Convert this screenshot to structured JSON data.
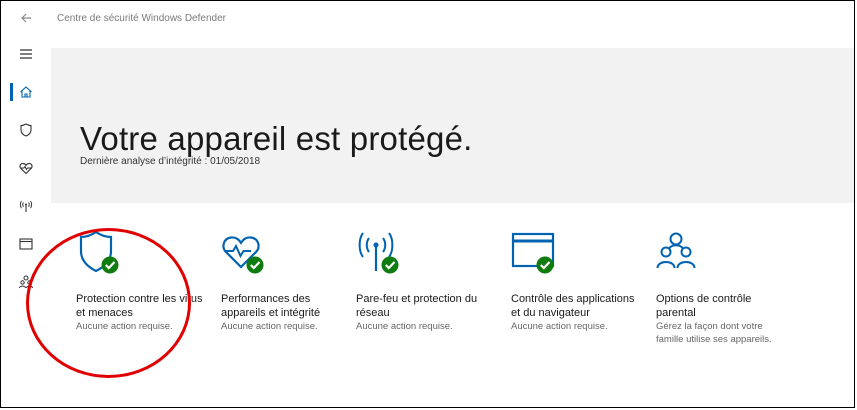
{
  "window": {
    "title": "Centre de sécurité Windows Defender"
  },
  "nav": {
    "items": [
      {
        "icon": "menu-icon"
      },
      {
        "icon": "home-icon",
        "active": true
      },
      {
        "icon": "shield-icon"
      },
      {
        "icon": "heart-icon"
      },
      {
        "icon": "antenna-icon"
      },
      {
        "icon": "browser-icon"
      },
      {
        "icon": "family-icon"
      }
    ]
  },
  "hero": {
    "title": "Votre appareil est protégé.",
    "last_scan": "Dernière analyse d’intégrité : 01/05/2018"
  },
  "tiles": [
    {
      "icon": "shield-check-icon",
      "title": "Protection contre les virus et menaces",
      "status": "Aucune action requise."
    },
    {
      "icon": "heart-check-icon",
      "title": "Performances des appareils et intégrité",
      "status": "Aucune action requise."
    },
    {
      "icon": "antenna-check-icon",
      "title": "Pare-feu et protection du réseau",
      "status": "Aucune action requise."
    },
    {
      "icon": "browser-check-icon",
      "title": "Contrôle des applications et du navigateur",
      "status": "Aucune action requise."
    },
    {
      "icon": "family-icon",
      "title": "Options de contrôle parental",
      "status": "Gérez la façon dont votre famille utilise ses appareils."
    }
  ],
  "colors": {
    "accent": "#0063b1",
    "check_green": "#107c10",
    "hero_bg": "#f2f2f2",
    "annotation_red": "#e00000"
  }
}
